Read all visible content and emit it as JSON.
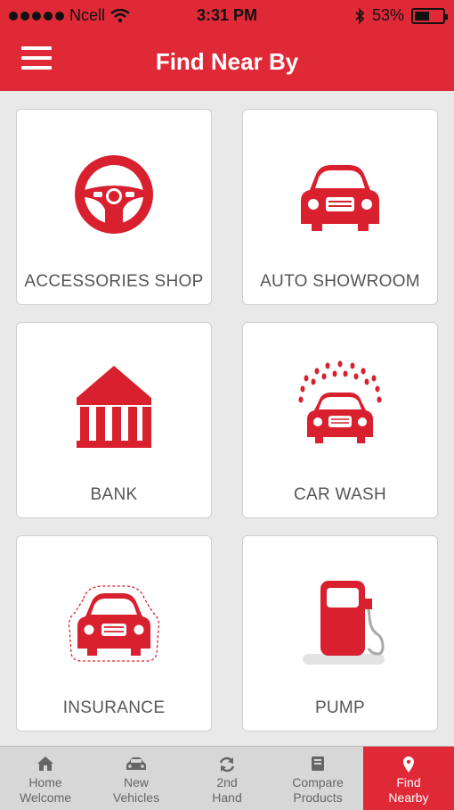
{
  "status": {
    "carrier": "Ncell",
    "time": "3:31 PM",
    "battery_text": "53%",
    "battery_level": 0.53
  },
  "header": {
    "title": "Find Near By",
    "accent_color": "#e02937"
  },
  "cards": [
    {
      "label": "ACCESSORIES SHOP",
      "icon": "steering-wheel-icon"
    },
    {
      "label": "AUTO SHOWROOM",
      "icon": "car-icon"
    },
    {
      "label": "BANK",
      "icon": "bank-icon"
    },
    {
      "label": "CAR WASH",
      "icon": "car-wash-icon"
    },
    {
      "label": "INSURANCE",
      "icon": "insured-car-icon"
    },
    {
      "label": "PUMP",
      "icon": "fuel-pump-icon"
    }
  ],
  "tabs": [
    {
      "line1": "Home",
      "line2": "Welcome",
      "icon": "home-icon"
    },
    {
      "line1": "New",
      "line2": "Vehicles",
      "icon": "car-icon"
    },
    {
      "line1": "2nd",
      "line2": "Hand",
      "icon": "refresh-icon"
    },
    {
      "line1": "Compare",
      "line2": "Products",
      "icon": "book-icon"
    },
    {
      "line1": "Find",
      "line2": "Nearby",
      "icon": "location-pin-icon",
      "active": true
    }
  ]
}
